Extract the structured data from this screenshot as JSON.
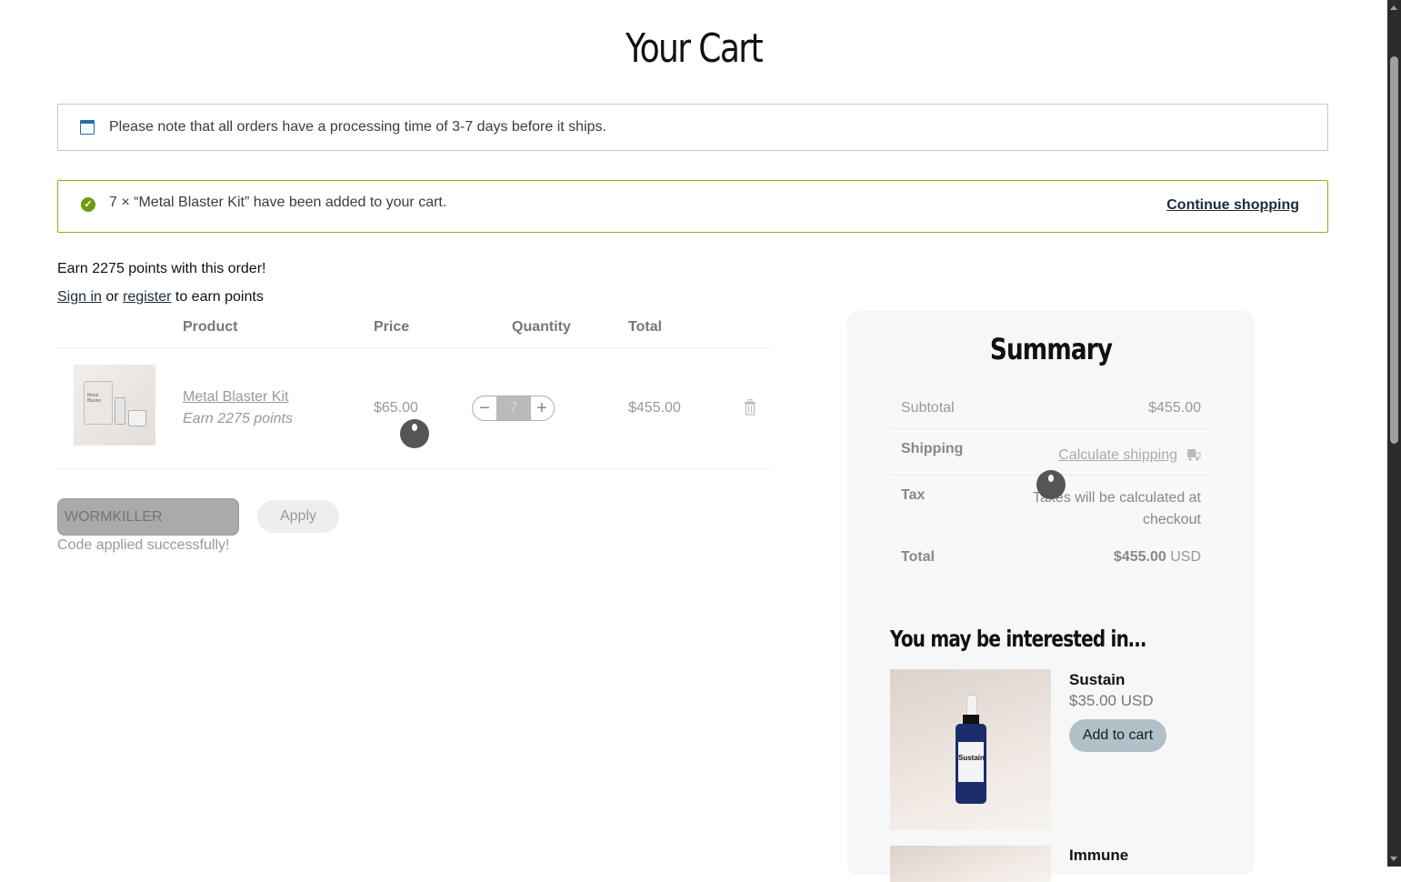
{
  "page": {
    "title": "Your Cart"
  },
  "notices": {
    "info": "Please note that all orders have a processing time of 3-7 days before it ships.",
    "success": "7 × “Metal Blaster Kit” have been added to your cart.",
    "continue_label": "Continue shopping"
  },
  "points": {
    "earn_text": "Earn 2275 points with this order!",
    "sign_in": "Sign in",
    "or": "or",
    "register": "register",
    "suffix": "to earn points"
  },
  "cart_table": {
    "headers": [
      "Product",
      "Price",
      "Quantity",
      "Total"
    ],
    "items": [
      {
        "name": "Metal Blaster Kit",
        "points": "Earn 2275 points",
        "price": "$65.00",
        "quantity": "7",
        "total": "$455.00",
        "thumb_label": "Metal Blaster"
      }
    ]
  },
  "coupon": {
    "placeholder": "WORMKILLER",
    "apply_label": "Apply",
    "message": "Code applied successfully!"
  },
  "summary": {
    "title": "Summary",
    "subtotal_label": "Subtotal",
    "subtotal_value": "$455.00",
    "shipping_label": "Shipping",
    "shipping_value": "Calculate shipping",
    "tax_label": "Tax",
    "tax_value": "Taxes will be calculated at checkout",
    "total_label": "Total",
    "total_amount": "$455.00",
    "total_currency": "USD"
  },
  "recommendations": {
    "title": "You may be interested in…",
    "items": [
      {
        "name": "Sustain",
        "price": "$35.00 USD",
        "button": "Add to cart",
        "bottle_label": "Sustain"
      },
      {
        "name": "Immune"
      }
    ]
  },
  "colors": {
    "success_border": "#8fae1b",
    "link": "#1d2b3a",
    "add_button": "#b2c0c9"
  },
  "icons": [
    "calendar-icon",
    "check-circle-icon",
    "trash-icon",
    "truck-icon",
    "minus-icon",
    "plus-icon"
  ]
}
